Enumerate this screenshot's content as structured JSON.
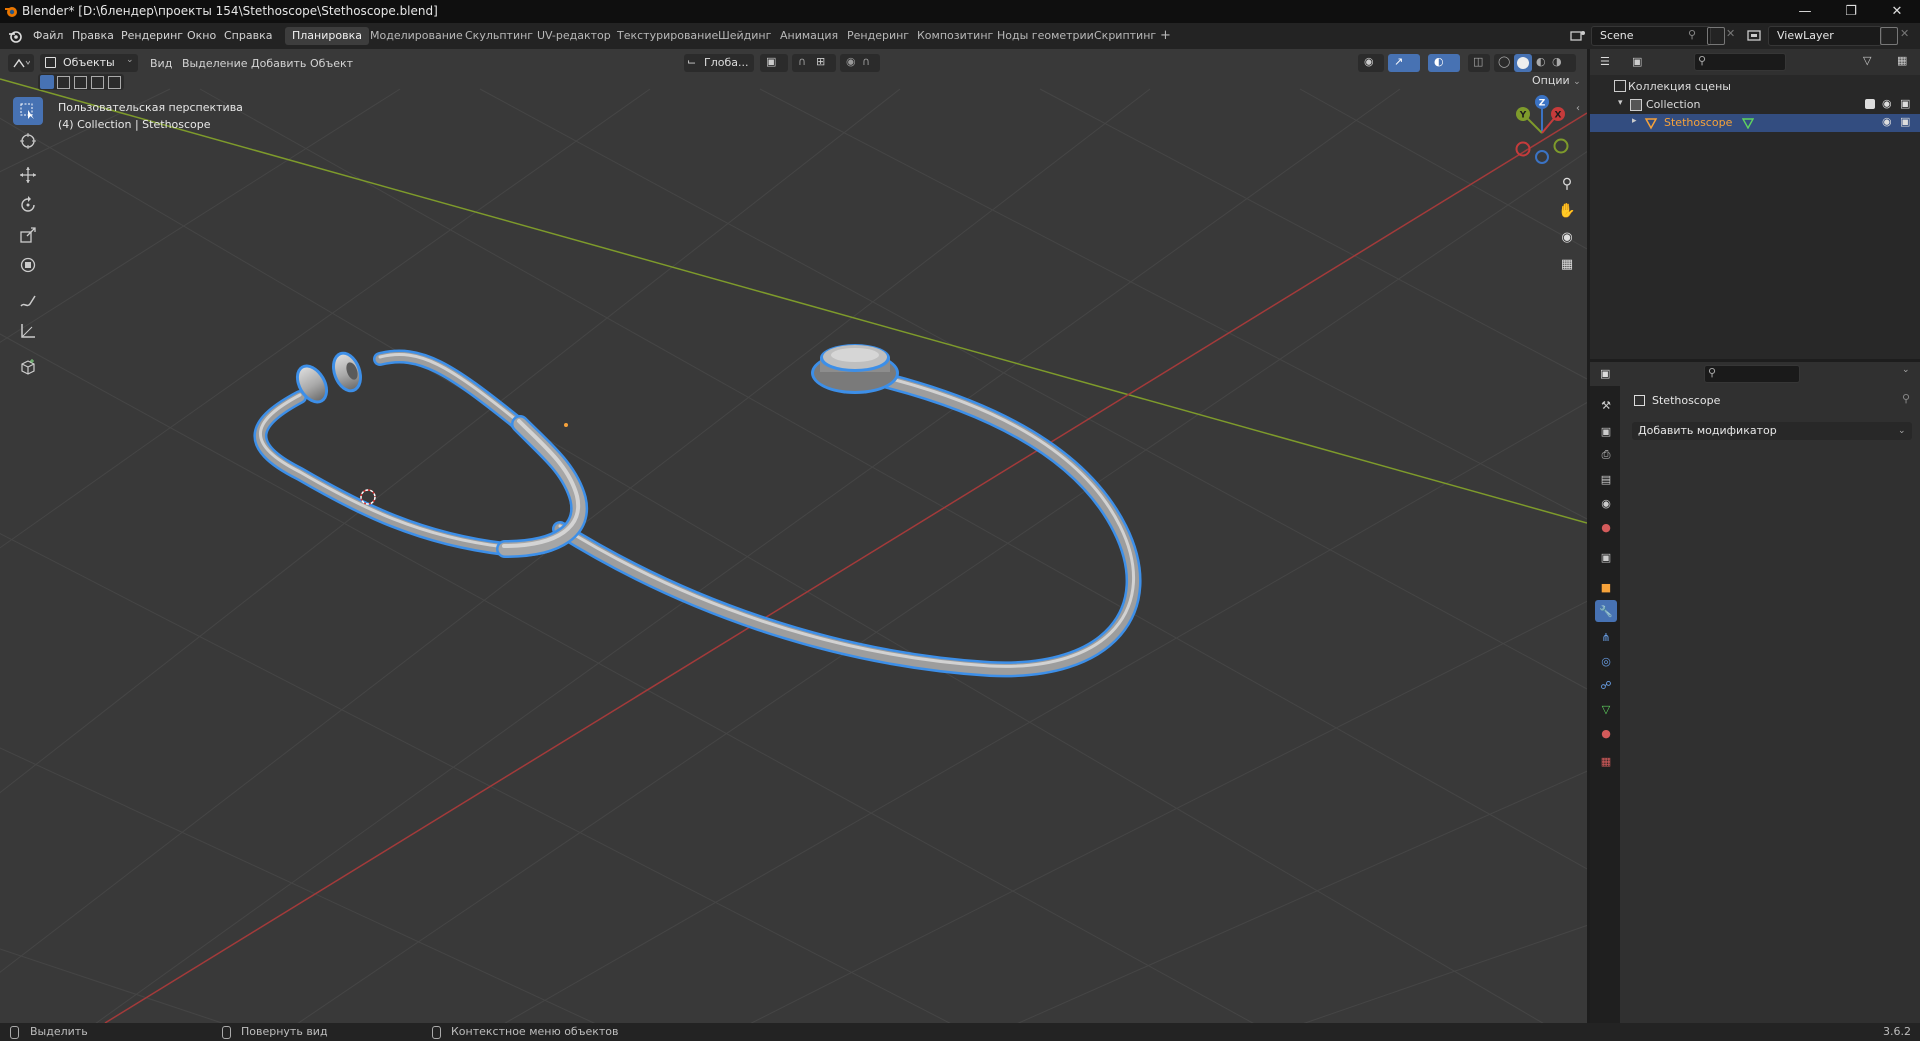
{
  "window": {
    "title": "Blender* [D:\\блендер\\проекты 154\\Stethoscope\\Stethoscope.blend]"
  },
  "menu": [
    "Файл",
    "Правка",
    "Рендеринг",
    "Окно",
    "Справка"
  ],
  "workspaces": [
    "Планировка",
    "Моделирование",
    "Скульптинг",
    "UV-редактор",
    "Текстурирование",
    "Шейдинг",
    "Анимация",
    "Рендеринг",
    "Композитинг",
    "Ноды геометрии",
    "Скриптинг"
  ],
  "active_workspace": "Планировка",
  "add_workspace": "+",
  "scene": {
    "name": "Scene"
  },
  "view_layer": {
    "name": "ViewLayer"
  },
  "viewport": {
    "mode": "Объекты",
    "menus": [
      "Вид",
      "Выделение",
      "Добавить",
      "Объект"
    ],
    "transform_orientation": "Глоба...",
    "options_label": "Опции",
    "perspective_label": "Пользовательская перспектива",
    "collection_label": "(4) Collection | Stethoscope",
    "gizmo": {
      "x": "X",
      "y": "Y",
      "z": "Z"
    }
  },
  "outliner": {
    "scene_collection": "Коллекция сцены",
    "collection": "Collection",
    "object": "Stethoscope"
  },
  "properties": {
    "object_name": "Stethoscope",
    "add_modifier": "Добавить модификатор"
  },
  "status": {
    "select": "Выделить",
    "rotate_view": "Повернуть вид",
    "context_menu": "Контекстное меню объектов",
    "version": "3.6.2"
  },
  "colors": {
    "accent": "#4772b3",
    "x_axis": "#a33a3a",
    "y_axis": "#7e9b2b",
    "selection_outline": "#3d8fe8",
    "active_object": "#f6a23a"
  }
}
